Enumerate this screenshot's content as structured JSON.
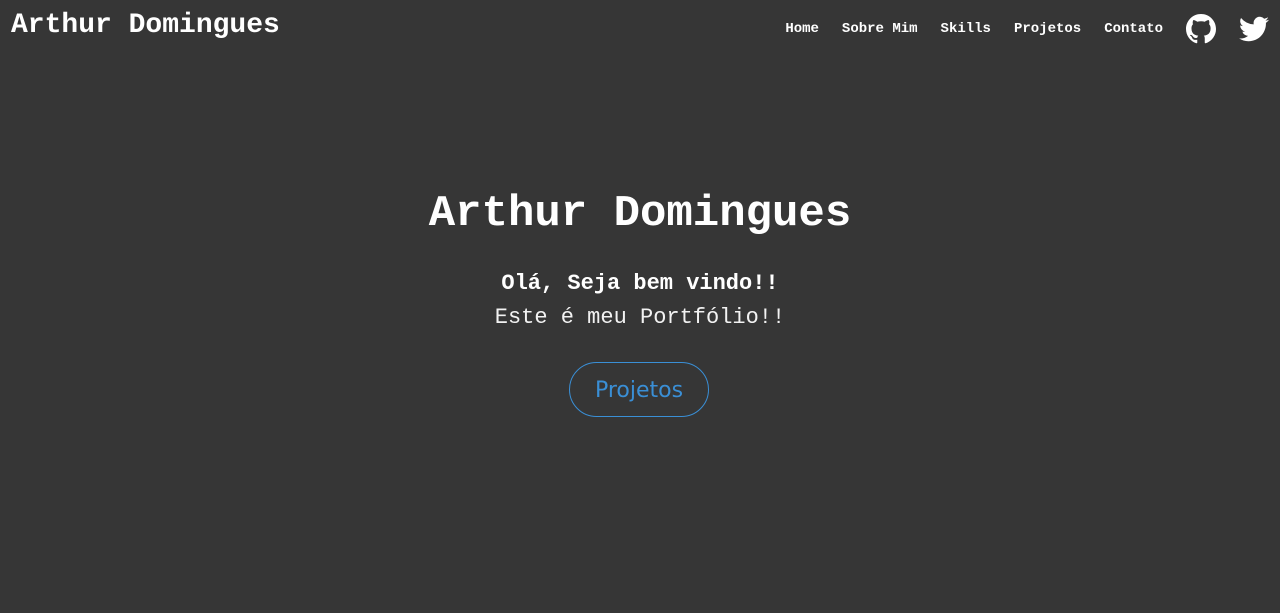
{
  "header": {
    "brand": "Arthur Domingues",
    "nav": [
      {
        "label": "Home"
      },
      {
        "label": "Sobre Mim"
      },
      {
        "label": "Skills"
      },
      {
        "label": "Projetos"
      },
      {
        "label": "Contato"
      }
    ],
    "social": [
      {
        "icon": "github-icon"
      },
      {
        "icon": "twitter-icon"
      }
    ]
  },
  "hero": {
    "title": "Arthur Domingues",
    "greeting": "Olá, Seja bem vindo!!",
    "subtitle": "Este é meu Portfólio!!",
    "button_label": "Projetos"
  },
  "colors": {
    "background": "#363636",
    "text": "#ffffff",
    "accent": "#3a8fd6"
  }
}
